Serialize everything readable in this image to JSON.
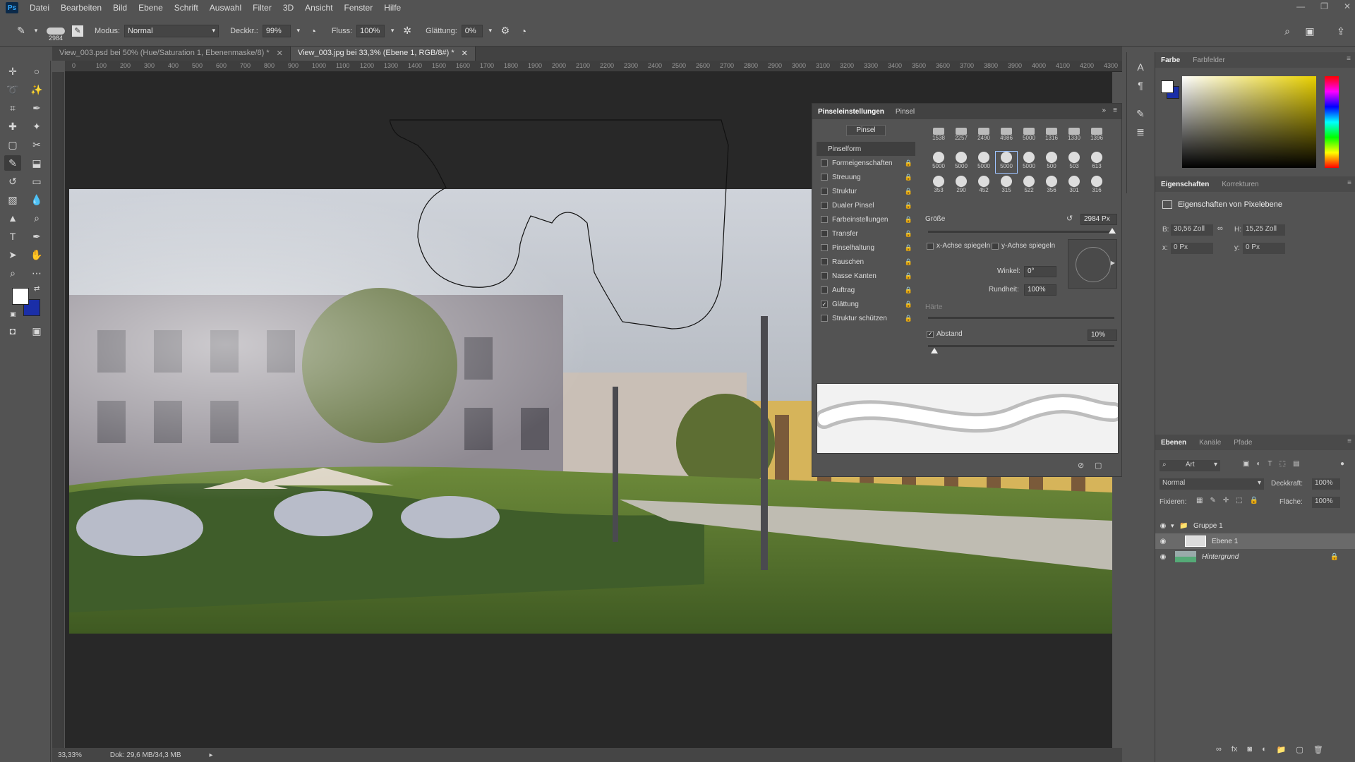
{
  "app": {
    "logo": "Ps"
  },
  "menu": [
    "Datei",
    "Bearbeiten",
    "Bild",
    "Ebene",
    "Schrift",
    "Auswahl",
    "Filter",
    "3D",
    "Ansicht",
    "Fenster",
    "Hilfe"
  ],
  "options": {
    "brush_size": "2984",
    "modus_label": "Modus:",
    "modus_value": "Normal",
    "deckkr_label": "Deckkr.:",
    "deckkr_value": "99%",
    "fluss_label": "Fluss:",
    "fluss_value": "100%",
    "glaettung_label": "Glättung:",
    "glaettung_value": "0%"
  },
  "tabs": [
    {
      "label": "View_003.psd bei 50% (Hue/Saturation 1, Ebenenmaske/8) *"
    },
    {
      "label": "View_003.jpg bei 33,3% (Ebene 1, RGB/8#) *"
    }
  ],
  "ruler_ticks": [
    "0",
    "100",
    "200",
    "300",
    "400",
    "500",
    "600",
    "700",
    "800",
    "900",
    "1000",
    "1100",
    "1200",
    "1300",
    "1400",
    "1500",
    "1600",
    "1700",
    "1800",
    "1900",
    "2000",
    "2100",
    "2200",
    "2300",
    "2400",
    "2500",
    "2600",
    "2700",
    "2800",
    "2900",
    "3000",
    "3100",
    "3200",
    "3300",
    "3400",
    "3500",
    "3600",
    "3700",
    "3800",
    "3900",
    "4000",
    "4100",
    "4200",
    "4300"
  ],
  "status": {
    "zoom": "33,33%",
    "doc": "Dok: 29,6 MB/34,3 MB"
  },
  "brush_panel": {
    "tab_settings": "Pinseleinstellungen",
    "tab_brush": "Pinsel",
    "pinsel_button": "Pinsel",
    "head": "Pinselform",
    "items": [
      {
        "label": "Formeigenschaften",
        "checked": false
      },
      {
        "label": "Streuung",
        "checked": false
      },
      {
        "label": "Struktur",
        "checked": false
      },
      {
        "label": "Dualer Pinsel",
        "checked": false
      },
      {
        "label": "Farbeinstellungen",
        "checked": false
      },
      {
        "label": "Transfer",
        "checked": false
      },
      {
        "label": "Pinselhaltung",
        "checked": false
      },
      {
        "label": "Rauschen",
        "checked": false
      },
      {
        "label": "Nasse Kanten",
        "checked": false
      },
      {
        "label": "Auftrag",
        "checked": false
      },
      {
        "label": "Glättung",
        "checked": true
      },
      {
        "label": "Struktur schützen",
        "checked": false
      }
    ],
    "tip_row1": [
      "1538",
      "2257",
      "2490",
      "4986",
      "5000",
      "1316",
      "1330",
      "1396"
    ],
    "tip_row2": [
      "5000",
      "5000",
      "5000",
      "5000",
      "5000",
      "500",
      "503",
      "613"
    ],
    "tip_row3": [
      "353",
      "290",
      "452",
      "315",
      "522",
      "356",
      "301",
      "316"
    ],
    "groesse_label": "Größe",
    "groesse_value": "2984 Px",
    "xflip": "x-Achse spiegeln",
    "yflip": "y-Achse spiegeln",
    "winkel_label": "Winkel:",
    "winkel_value": "0°",
    "rundheit_label": "Rundheit:",
    "rundheit_value": "100%",
    "haerte_label": "Härte",
    "abstand_label": "Abstand",
    "abstand_value": "10%"
  },
  "color_panel": {
    "tab1": "Farbe",
    "tab2": "Farbfelder"
  },
  "props_panel": {
    "tab1": "Eigenschaften",
    "tab2": "Korrekturen",
    "title": "Eigenschaften von Pixelebene",
    "b_label": "B:",
    "b_value": "30,56 Zoll",
    "h_label": "H:",
    "h_value": "15,25 Zoll",
    "x_label": "x:",
    "x_value": "0 Px",
    "y_label": "y:",
    "y_value": "0 Px"
  },
  "layers_panel": {
    "tab1": "Ebenen",
    "tab2": "Kanäle",
    "tab3": "Pfade",
    "filter": "Art",
    "blend": "Normal",
    "deckkraft_label": "Deckkraft:",
    "deckkraft_value": "100%",
    "fixieren_label": "Fixieren:",
    "flaeche_label": "Fläche:",
    "flaeche_value": "100%",
    "layers": [
      {
        "name": "Gruppe 1"
      },
      {
        "name": "Ebene 1"
      },
      {
        "name": "Hintergrund"
      }
    ]
  },
  "colors": {
    "fg": "#ffffff",
    "bg": "#1a2ea8"
  }
}
